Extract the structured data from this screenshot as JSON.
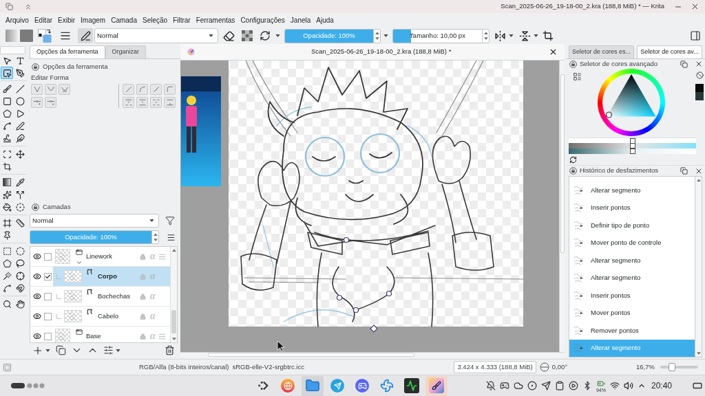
{
  "window": {
    "title": "Scan_2025-06-26_19-18-00_2.kra (188,8 MiB) * — Krita"
  },
  "menu": [
    "Arquivo",
    "Editar",
    "Exibir",
    "Imagem",
    "Camada",
    "Seleção",
    "Filtrar",
    "Ferramentas",
    "Configurações",
    "Janela",
    "Ajuda"
  ],
  "toolbar": {
    "blend_mode": "Normal",
    "opacity": {
      "label": "Opacidade: 100%",
      "level": 1
    },
    "size": {
      "label": "Tamanho: 10,00 px",
      "level": 0.2
    }
  },
  "toolbox": {
    "groups": [
      {
        "tools": [
          {
            "kind": "select",
            "selected": false
          },
          {
            "kind": "text",
            "selected": false
          },
          {
            "kind": "edit-shape",
            "selected": true
          },
          {
            "kind": "calligraphy",
            "selected": false
          }
        ]
      },
      {
        "tools": [
          {
            "kind": "brush",
            "selected": false
          },
          {
            "kind": "line",
            "selected": false
          },
          {
            "kind": "rectangle",
            "selected": false
          },
          {
            "kind": "ellipse",
            "selected": false
          },
          {
            "kind": "polygon",
            "selected": false
          },
          {
            "kind": "polyline",
            "selected": false
          },
          {
            "kind": "bezier",
            "selected": false
          },
          {
            "kind": "freehand-path",
            "selected": false
          },
          {
            "kind": "dynamic-brush",
            "selected": false
          },
          {
            "kind": "multibrush",
            "selected": false
          }
        ]
      },
      {
        "tools": [
          {
            "kind": "transform",
            "selected": false
          },
          {
            "kind": "move",
            "selected": false
          },
          {
            "kind": "crop",
            "selected": false
          }
        ]
      },
      {
        "tools": [
          {
            "kind": "gradient",
            "selected": false
          },
          {
            "kind": "color-picker",
            "selected": false
          },
          {
            "kind": "smart-patch",
            "selected": false
          },
          {
            "kind": "colorize",
            "selected": false
          },
          {
            "kind": "fill",
            "selected": false
          },
          {
            "kind": "enclose-fill",
            "selected": false
          }
        ]
      },
      {
        "tools": [
          {
            "kind": "assistant",
            "selected": false
          },
          {
            "kind": "measure",
            "selected": false
          },
          {
            "kind": "reference",
            "selected": false
          }
        ]
      },
      {
        "tools": [
          {
            "kind": "rect-select",
            "selected": false
          },
          {
            "kind": "ellipse-select",
            "selected": false
          },
          {
            "kind": "polygon-select",
            "selected": false
          },
          {
            "kind": "freehand-select",
            "selected": false
          },
          {
            "kind": "contiguous-select",
            "selected": false
          },
          {
            "kind": "similar-select",
            "selected": false
          },
          {
            "kind": "bezier-select",
            "selected": false
          },
          {
            "kind": "magnetic-select",
            "selected": false
          }
        ]
      },
      {
        "tools": [
          {
            "kind": "zoom",
            "selected": false
          },
          {
            "kind": "pan",
            "selected": false
          }
        ]
      }
    ]
  },
  "tool_options": {
    "tabs": [
      {
        "label": "Opções da ferramenta",
        "selected": true
      },
      {
        "label": "Organizar",
        "selected": false
      }
    ],
    "title": "Opções da ferramenta",
    "section": "Editar Forma"
  },
  "layers": {
    "title": "Camadas",
    "blend_mode": "Normal",
    "opacity": {
      "label": "Opacidade: 100%",
      "level": 1
    },
    "items": [
      {
        "name": "Linework",
        "kind": "group",
        "expanded": true,
        "selected": false,
        "checked": false,
        "alpha": "α",
        "children": [
          {
            "name": "Corpo",
            "kind": "vector",
            "selected": true,
            "checked": true,
            "alpha": "α"
          },
          {
            "name": "Bochechas",
            "kind": "vector",
            "selected": false,
            "checked": false,
            "alpha": "α"
          },
          {
            "name": "Cabelo",
            "kind": "vector",
            "selected": false,
            "checked": false,
            "alpha": "α"
          }
        ]
      },
      {
        "name": "Base",
        "kind": "group",
        "selected": false,
        "checked": false,
        "alpha": "α"
      }
    ]
  },
  "document": {
    "title": "Scan_2025-06-26_19-18-00_2.kra (188,8 MiB) *"
  },
  "color_selector": {
    "tabs": [
      {
        "label": "Seletor de cores es...",
        "selected": false
      },
      {
        "label": "Seletor de cores av...",
        "selected": true
      }
    ],
    "title": "Seletor de cores avançado",
    "current_colors": [
      {
        "color": "#0a0a0a"
      },
      {
        "color": "#243a38"
      }
    ],
    "shade_bars": [
      {
        "level": 0.5
      },
      {
        "level": 0.5
      },
      {
        "level": 0.5
      }
    ]
  },
  "history": {
    "title": "Histórico de desfazimentos",
    "items": [
      {
        "label": "Alterar segmento",
        "selected": false
      },
      {
        "label": "Inserir pontos",
        "selected": false
      },
      {
        "label": "Definir tipo de ponto",
        "selected": false
      },
      {
        "label": "Mover ponto de controle",
        "selected": false
      },
      {
        "label": "Alterar segmento",
        "selected": false
      },
      {
        "label": "Alterar segmento",
        "selected": false
      },
      {
        "label": "Inserir pontos",
        "selected": false
      },
      {
        "label": "Mover pontos",
        "selected": false
      },
      {
        "label": "Remover pontos",
        "selected": false
      },
      {
        "label": "Alterar segmento",
        "selected": true
      }
    ]
  },
  "status_bar": {
    "color_model": "RGB/Alfa (8-bits inteiros/canal)",
    "profile": "sRGB-elle-V2-srgbtrc.icc",
    "image_size": "3.424 x 4.333 (188,8 MiB)",
    "rotation": "0,00°",
    "zoom": {
      "label": "16,7%",
      "level": 0.3
    }
  },
  "taskbar": {
    "apps": [
      {
        "kind": "launcher",
        "selected": false,
        "running": false
      },
      {
        "kind": "browser",
        "selected": false,
        "running": false
      },
      {
        "kind": "files",
        "selected": false,
        "running": true
      },
      {
        "kind": "messenger",
        "selected": false,
        "running": false
      },
      {
        "kind": "chat",
        "selected": false,
        "running": false
      },
      {
        "kind": "fan",
        "selected": false,
        "running": false
      },
      {
        "kind": "monitor",
        "selected": false,
        "running": false
      },
      {
        "kind": "paint",
        "selected": true,
        "running": true
      }
    ],
    "battery": "94%",
    "clock": "20:40"
  }
}
